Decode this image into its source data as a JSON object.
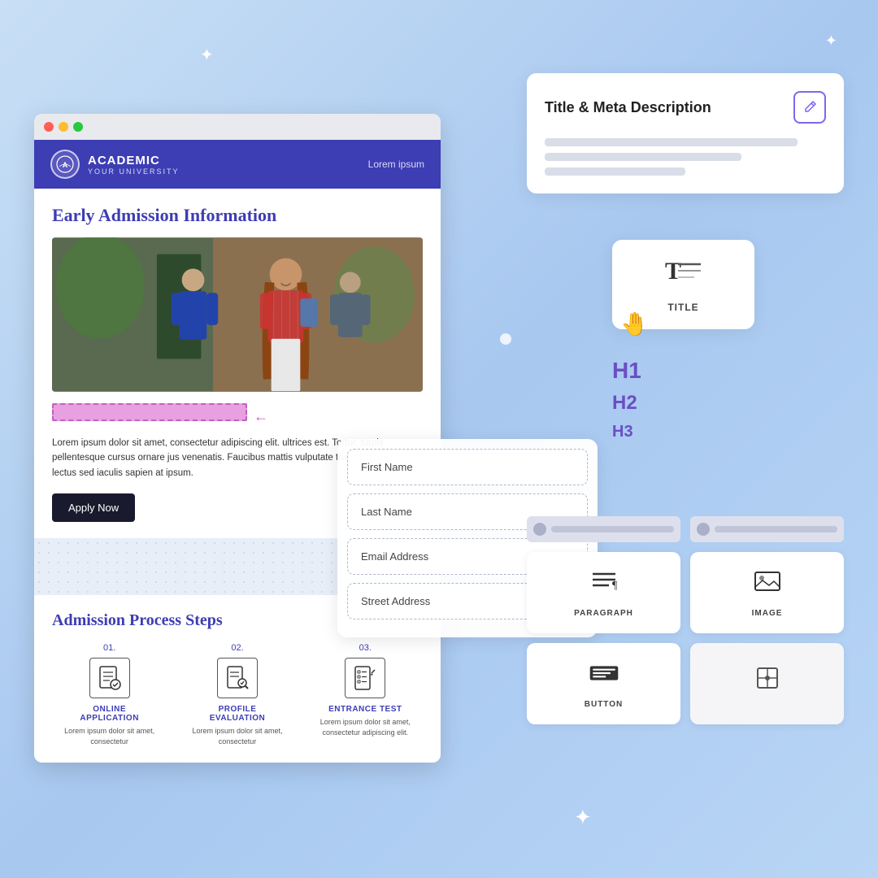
{
  "decorative": {
    "star1_symbol": "✦",
    "star2_symbol": "✦",
    "star3_symbol": "✦"
  },
  "browser": {
    "dots": [
      "red",
      "yellow",
      "green"
    ]
  },
  "university": {
    "logo_initials": "A",
    "name_main": "ACADEMIC",
    "name_sub": "YOUR UNIVERSITY",
    "nav_text": "Lorem ipsum"
  },
  "site": {
    "heading": "Early Admission Information",
    "body_text": "Lorem ipsum dolor sit amet, consectetur adipiscing elit. ultrices est. Tortor, turpis pellentesque cursus ornare jus venenatis. Faucibus mattis vulputate tristique nisl, males lectus sed iaculis sapien at ipsum.",
    "apply_button": "Apply Now",
    "process_title": "Admission Process Steps",
    "steps": [
      {
        "num": "01.",
        "label": "ONLINE\nAPPLICATION",
        "desc": "Lorem ipsum dolor sit\namet, consectetur"
      },
      {
        "num": "02.",
        "label": "PROFILE\nEVALUATION",
        "desc": "Lorem ipsum dolor sit\namet, consectetur"
      },
      {
        "num": "03.",
        "label": "ENTRANCE TEST",
        "desc": "Lorem ipsum dolor sit\namet, consectetur\nadipiscing elit."
      }
    ]
  },
  "form": {
    "fields": [
      {
        "placeholder": "First Name"
      },
      {
        "placeholder": "Last Name"
      },
      {
        "placeholder": "Email Address"
      },
      {
        "placeholder": "Street Address"
      }
    ]
  },
  "right_panel": {
    "meta_title": "Title & Meta Description",
    "edit_icon": "✏",
    "lines": [
      "long",
      "medium",
      "short"
    ]
  },
  "title_widget": {
    "label": "TITLE"
  },
  "headings": {
    "h1": "H1",
    "h2": "H2",
    "h3": "H3"
  },
  "components": {
    "paragraph_label": "PARAGRAPH",
    "image_label": "IMAGE",
    "button_label": "BUTTON"
  }
}
